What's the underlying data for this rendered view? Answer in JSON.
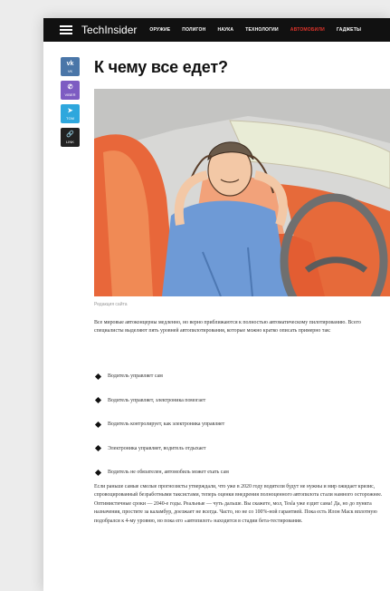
{
  "header": {
    "logo": "TechInsider",
    "nav": [
      {
        "label": "ОРУЖИЕ",
        "active": false
      },
      {
        "label": "ПОЛИГОН",
        "active": false
      },
      {
        "label": "НАУКА",
        "active": false
      },
      {
        "label": "ТЕХНОЛОГИИ",
        "active": false
      },
      {
        "label": "АВТОМОБИЛИ",
        "active": true
      },
      {
        "label": "ГАДЖЕТЫ",
        "active": false
      }
    ],
    "active_color": "#e0342b"
  },
  "share": [
    {
      "icon": "vk-icon",
      "glyph": "vk",
      "label": "VK"
    },
    {
      "icon": "viber-icon",
      "glyph": "✆",
      "label": "VIBER"
    },
    {
      "icon": "telegram-icon",
      "glyph": "➤",
      "label": "TGM"
    },
    {
      "icon": "link-icon",
      "glyph": "🔗",
      "label": "LINK"
    }
  ],
  "article": {
    "title": "К чему все едет?",
    "image_caption": "Редакция сайта",
    "intro": "Все мировые автоконцерны медленно, но верно приближаются к полностью автоматическому пилотированию. Всего специалисты выделяют пять уровней автопилотирования, которые можно кратко описать примерно так:",
    "levels": [
      "Водитель управляет сам",
      "Водитель управляет, электроника помогает",
      "Водитель контролирует, как электроника управляет",
      "Электроника управляет, водитель отдыхает",
      "Водитель не обязателен, автомобиль может ехать сам"
    ],
    "conclusion": "Если раньше самые смелые прогнозисты утверждали, что уже в 2020 году водители будут не нужны и мир ожидает кризис, спровоцированный безработными таксистами, теперь оценки внедрения полноценного автопилота стали намного осторожнее. Оптимистичные сроки — 2040-е годы. Реальные — чуть дальше. Вы скажете, мол, Tesla уже ездит сама! Да, но до пункта назначения, простите за каламбур, доезжает не всегда. Часто, но не со 100%-ной гарантией. Пока есть Илон Маск вплотную подобрался к 4-му уровню, но пока его «автопилот» находится в стадии бета-тестирования."
  },
  "colors": {
    "vk": "#4a76a8",
    "viber": "#7d5cc2",
    "telegram": "#2ea7dd",
    "link": "#222222"
  }
}
